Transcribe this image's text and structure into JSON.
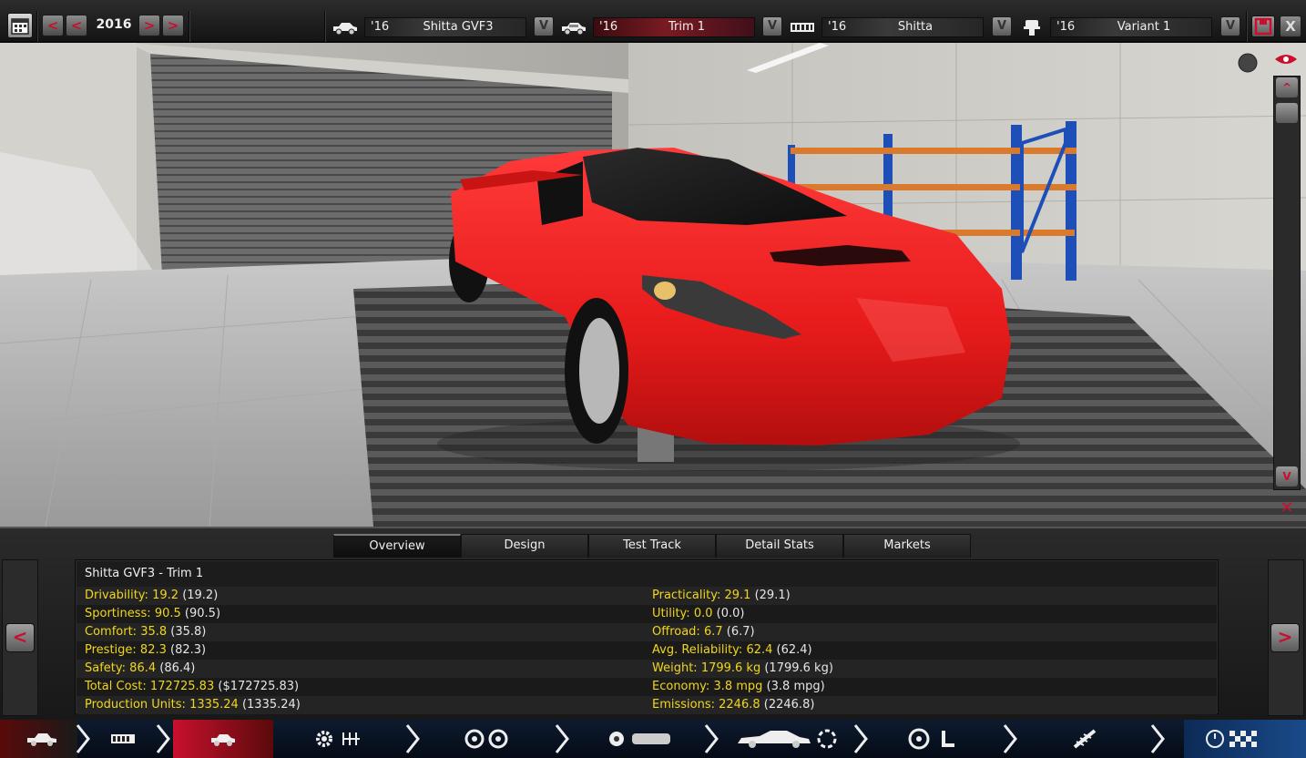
{
  "topbar": {
    "year": "2016",
    "year_prev_labels": [
      "<",
      "<"
    ],
    "year_next_labels": [
      ">",
      ">"
    ],
    "model": {
      "year": "'16",
      "name": "Shitta GVF3"
    },
    "trim": {
      "year": "'16",
      "name": "Trim 1"
    },
    "engine_family": {
      "year": "'16",
      "name": "Shitta"
    },
    "engine_variant": {
      "year": "'16",
      "name": "Variant 1"
    },
    "dropdown_label": "V",
    "save_label": "",
    "close_label": "X"
  },
  "viewport": {
    "scroll_up": "^",
    "scroll_down": "V"
  },
  "tabs": [
    {
      "label": "Overview",
      "active": true
    },
    {
      "label": "Design",
      "active": false
    },
    {
      "label": "Test Track",
      "active": false
    },
    {
      "label": "Detail Stats",
      "active": false
    },
    {
      "label": "Markets",
      "active": false
    }
  ],
  "overview": {
    "title": "Shitta GVF3 - Trim 1",
    "left": [
      {
        "label": "Drivability:",
        "value": "19.2",
        "paren": "(19.2)"
      },
      {
        "label": "Sportiness:",
        "value": "90.5",
        "paren": "(90.5)"
      },
      {
        "label": "Comfort:",
        "value": "35.8",
        "paren": "(35.8)"
      },
      {
        "label": "Prestige:",
        "value": "82.3",
        "paren": "(82.3)"
      },
      {
        "label": "Safety:",
        "value": "86.4",
        "paren": "(86.4)"
      },
      {
        "label": "Total Cost:",
        "value": "172725.83",
        "paren": "($172725.83)"
      },
      {
        "label": "Production Units:",
        "value": "1335.24",
        "paren": "(1335.24)"
      }
    ],
    "right": [
      {
        "label": "Practicality:",
        "value": "29.1",
        "paren": "(29.1)"
      },
      {
        "label": "Utility:",
        "value": "0.0",
        "paren": "(0.0)"
      },
      {
        "label": "Offroad:",
        "value": "6.7",
        "paren": "(6.7)"
      },
      {
        "label": "Avg. Reliability:",
        "value": "62.4",
        "paren": "(62.4)"
      },
      {
        "label": "Weight:",
        "value": "1799.6 kg",
        "paren": "(1799.6 kg)"
      },
      {
        "label": "Economy:",
        "value": "3.8 mpg",
        "paren": "(3.8 mpg)"
      },
      {
        "label": "Emissions:",
        "value": "2246.8",
        "paren": "(2246.8)"
      }
    ]
  },
  "nav_arrows": {
    "prev": "<",
    "next": ">"
  },
  "bottom_nav": [
    {
      "icon": "car-model-icon",
      "active": false
    },
    {
      "icon": "engine-block-icon",
      "active": false
    },
    {
      "icon": "car-trim-icon",
      "active": true
    },
    {
      "icon": "drivetrain-gearbox-icon",
      "active": false
    },
    {
      "icon": "wheels-brakes-icon",
      "active": false
    },
    {
      "icon": "rim-chassis-icon",
      "active": false
    },
    {
      "icon": "body-aero-icon",
      "active": false
    },
    {
      "icon": "interior-steering-seat-icon",
      "active": false
    },
    {
      "icon": "suspension-spring-icon",
      "active": false
    },
    {
      "icon": "test-finish-icon",
      "active": false
    }
  ],
  "colors": {
    "accent_red": "#c8102e",
    "stat_yellow": "#f2d61b",
    "car_red": "#e81b1b"
  }
}
